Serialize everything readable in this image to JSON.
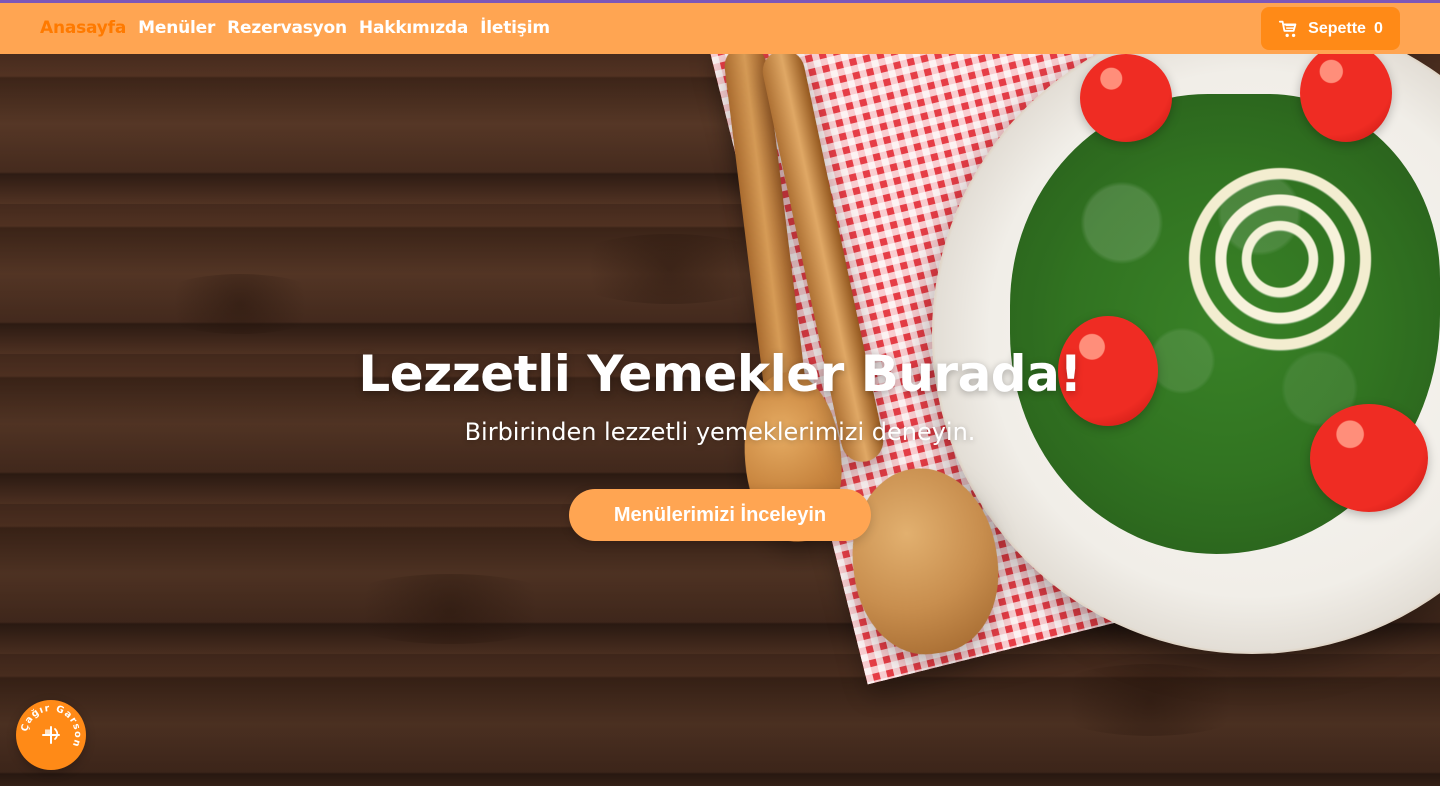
{
  "nav": {
    "links": [
      {
        "label": "Anasayfa",
        "active": true
      },
      {
        "label": "Menüler",
        "active": false
      },
      {
        "label": "Rezervasyon",
        "active": false
      },
      {
        "label": "Hakkımızda",
        "active": false
      },
      {
        "label": "İletişim",
        "active": false
      }
    ],
    "cart": {
      "label": "Sepette",
      "count": "0",
      "icon": "cart-icon"
    }
  },
  "hero": {
    "title": "Lezzetli Yemekler Burada!",
    "subtitle": "Birbirinden lezzetli yemeklerimizi deneyin.",
    "button_label": "Menülerimizi İnceleyin"
  },
  "badge": {
    "label": "Çağır Garson",
    "icon": "utensils-icon"
  },
  "colors": {
    "accent": "#ffa552",
    "active": "#ff7a00",
    "cart": "#ff8a17",
    "top_strip": "#7d57b8"
  }
}
